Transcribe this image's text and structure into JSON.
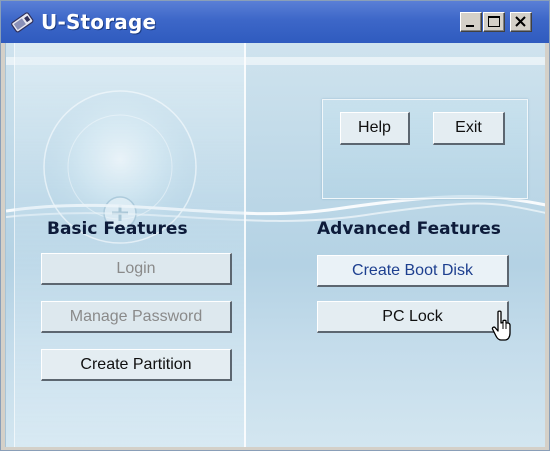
{
  "window": {
    "title": "U-Storage",
    "controls": [
      "minimize",
      "maximize",
      "close"
    ]
  },
  "icons": {
    "app": "disk-icon",
    "minimize": "minimize-icon",
    "maximize": "maximize-icon",
    "close": "close-icon",
    "cursor": "hand-pointer-icon"
  },
  "top_actions": {
    "help_label": "Help",
    "exit_label": "Exit"
  },
  "basic": {
    "title": "Basic Features",
    "buttons": [
      {
        "label": "Login",
        "enabled": false
      },
      {
        "label": "Manage Password",
        "enabled": false
      },
      {
        "label": "Create Partition",
        "enabled": true
      }
    ]
  },
  "advanced": {
    "title": "Advanced Features",
    "buttons": [
      {
        "label": "Create Boot Disk",
        "enabled": true,
        "hovered": true
      },
      {
        "label": "PC Lock",
        "enabled": true
      }
    ]
  },
  "colors": {
    "titlebar": "#3d67c8",
    "background": "#bfd9e8",
    "section_title": "#0d1b3a",
    "disabled_text": "#8a8a8a",
    "hover_text": "#1d3f8f"
  }
}
